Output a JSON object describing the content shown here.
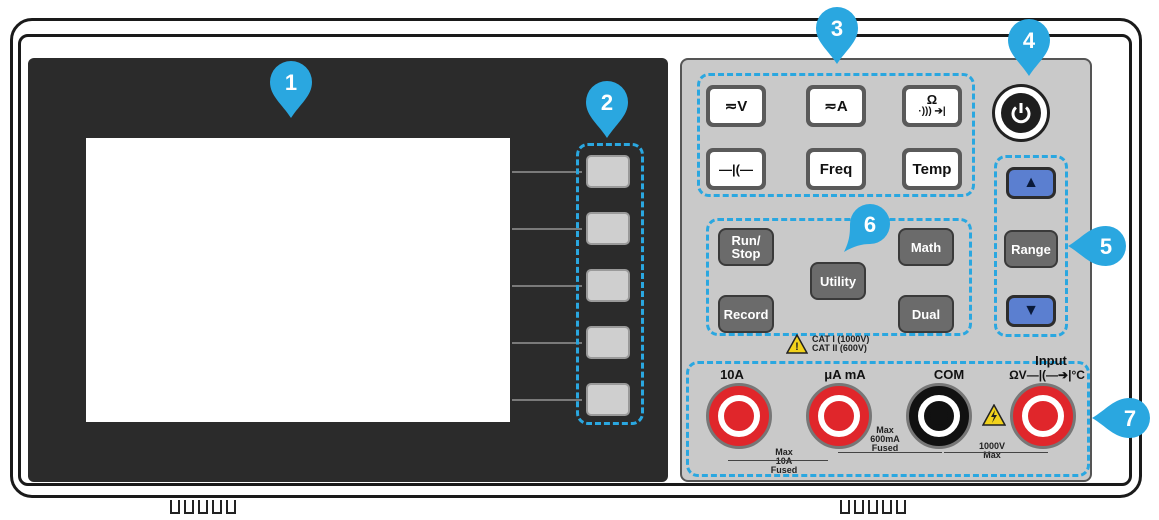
{
  "callouts": [
    "1",
    "2",
    "3",
    "4",
    "5",
    "6",
    "7"
  ],
  "function_keys": [
    "≂V",
    "≂A",
    "Ω",
    "—|(—",
    "Freq",
    "Temp"
  ],
  "function_keys_ohm_sub": "·))) ➔|",
  "control_keys": {
    "run_stop_1": "Run/",
    "run_stop_2": "Stop",
    "utility": "Utility",
    "math": "Math",
    "record": "Record",
    "dual": "Dual"
  },
  "range_keys": {
    "up": "▲",
    "range": "Range",
    "down": "▼"
  },
  "cat_rating": {
    "line1": "CAT I (1000V)",
    "line2": "CAT II (600V)"
  },
  "terminals": {
    "t10a": "10A",
    "tua": "μA mA",
    "tcom": "COM",
    "tinput": "Input",
    "tinput_sub": "ΩV—|(—➔|°C",
    "f1_1": "Max",
    "f1_2": "10A",
    "f1_3": "Fused",
    "f2_1": "Max",
    "f2_2": "600mA",
    "f2_3": "Fused",
    "f3_1": "1000V",
    "f3_2": "Max"
  },
  "colors": {
    "callout": "#2aa7e0",
    "dash": "#2aa7e0",
    "jack_red": "#e0262b",
    "jack_black": "#111111"
  }
}
